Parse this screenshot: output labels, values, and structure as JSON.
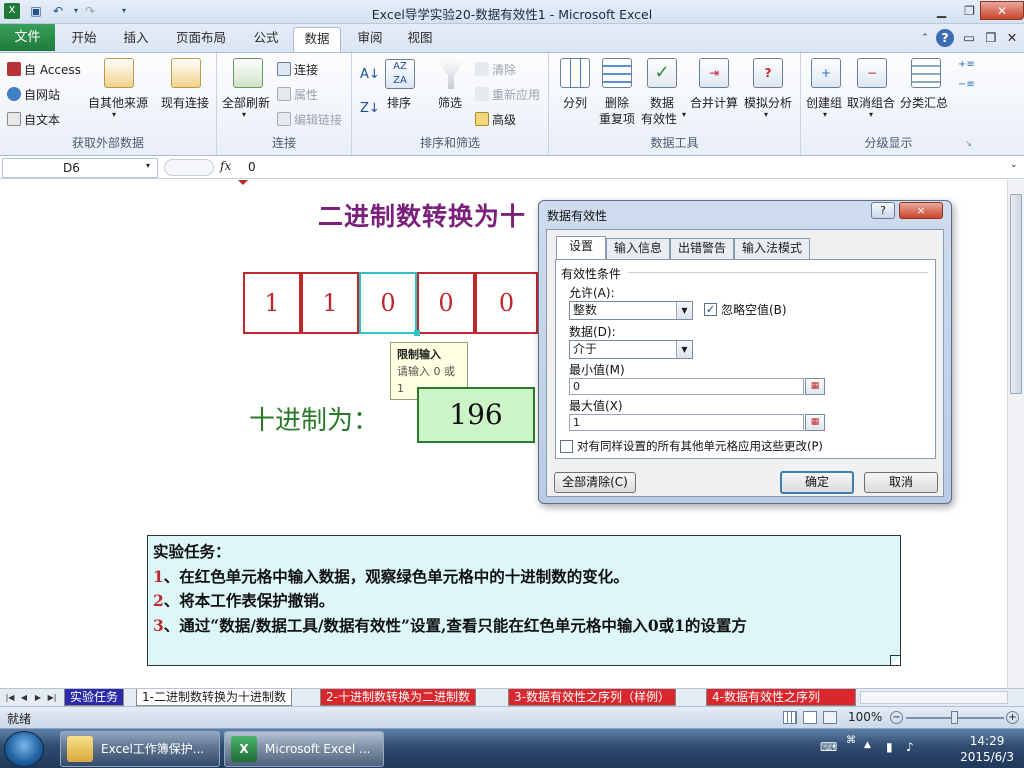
{
  "window": {
    "title": "Excel导学实验20-数据有效性1  -  Microsoft Excel"
  },
  "ribbon_tabs": [
    "文件",
    "开始",
    "插入",
    "页面布局",
    "公式",
    "数据",
    "审阅",
    "视图"
  ],
  "groups": {
    "external": {
      "label": "获取外部数据",
      "access": "自 Access",
      "web": "自网站",
      "text": "自文本",
      "other": "自其他来源",
      "existing": "现有连接"
    },
    "connections": {
      "label": "连接",
      "refresh": "全部刷新",
      "connections": "连接",
      "properties": "属性",
      "edit_links": "编辑链接"
    },
    "sort": {
      "label": "排序和筛选",
      "sort": "排序",
      "filter": "筛选",
      "clear": "清除",
      "reapply": "重新应用",
      "advanced": "高级"
    },
    "tools": {
      "label": "数据工具",
      "split": "分列",
      "remove_dup_1": "删除",
      "remove_dup_2": "重复项",
      "validation_1": "数据",
      "validation_2": "有效性",
      "consolidate": "合并计算",
      "whatif": "模拟分析"
    },
    "outline": {
      "label": "分级显示",
      "group": "创建组",
      "ungroup": "取消组合",
      "subtotal": "分类汇总"
    }
  },
  "formula_bar": {
    "name_box": "D6",
    "fx": "fx",
    "value": "0"
  },
  "sheet": {
    "title": "二进制数转换为十",
    "bits": [
      "1",
      "1",
      "0",
      "0",
      "0"
    ],
    "tooltip": {
      "title": "限制输入",
      "body": "请输入 0 或 1"
    },
    "decimal_label": "十进制为：",
    "decimal_value": "196",
    "task_title": "实验任务：",
    "tasks": [
      {
        "n": "1",
        "text": "、在红色单元格中输入数据，观察绿色单元格中的十进制数的变化。"
      },
      {
        "n": "2",
        "text": "、将本工作表保护撤销。"
      },
      {
        "n": "3",
        "text": "、通过“数据/数据工具/数据有效性”设置,查看只能在红色单元格中输入0或1的设置方"
      }
    ]
  },
  "dialog": {
    "title": "数据有效性",
    "help": "?",
    "close": "×",
    "tabs": [
      "设置",
      "输入信息",
      "出错警告",
      "输入法模式"
    ],
    "criteria_label": "有效性条件",
    "allow_label": "允许(A):",
    "allow_value": "整数",
    "ignore_blank": "忽略空值(B)",
    "data_label": "数据(D):",
    "data_value": "介于",
    "min_label": "最小值(M)",
    "min_value": "0",
    "max_label": "最大值(X)",
    "max_value": "1",
    "apply_all": "对有同样设置的所有其他单元格应用这些更改(P)",
    "clear_all": "全部清除(C)",
    "ok": "确定",
    "cancel": "取消"
  },
  "sheet_tabs": [
    "实验任务",
    "1-二进制数转换为十进制数",
    "2-十进制数转换为二进制数",
    "3-数据有效性之序列（样例）",
    "4-数据有效性之序列"
  ],
  "status": {
    "ready": "就绪",
    "zoom": "100%"
  },
  "taskbar": {
    "task1": "Excel工作簿保护...",
    "task2": "Microsoft Excel ...",
    "time": "14:29",
    "date": "2015/6/3"
  },
  "colors": {
    "bit_border": "#c0272d",
    "decimal_fill": "#ccf5c7",
    "task_fill": "#ddf7f8",
    "title": "#7a1f7a"
  }
}
